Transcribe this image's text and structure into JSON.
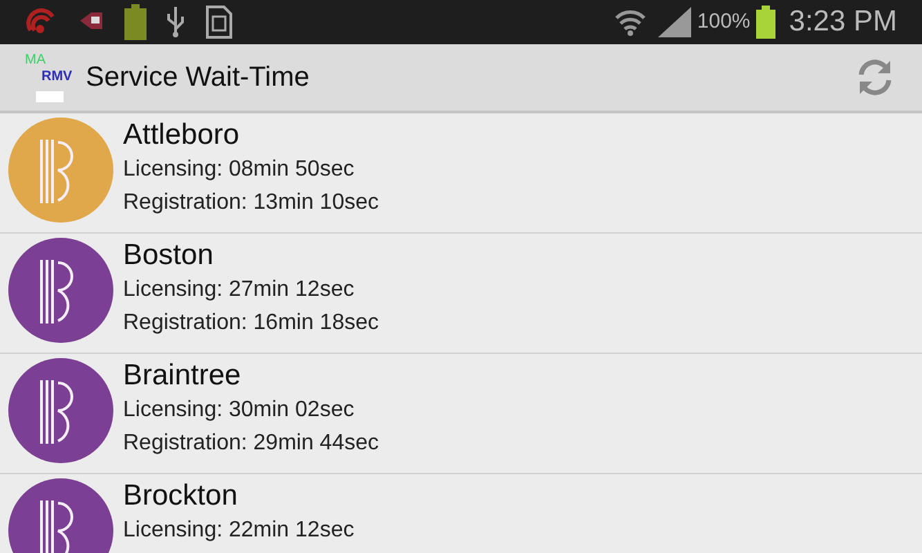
{
  "status_bar": {
    "battery_percent": "100%",
    "time": "3:23 PM"
  },
  "app_bar": {
    "logo": {
      "line_1": "MA",
      "line_2": "RMV"
    },
    "title": "Service Wait-Time"
  },
  "branches": [
    {
      "name": "Attleboro",
      "licensing": "Licensing: 08min 50sec",
      "registration": "Registration: 13min 10sec",
      "color": "#e0a84a"
    },
    {
      "name": "Boston",
      "licensing": "Licensing: 27min 12sec",
      "registration": "Registration: 16min 18sec",
      "color": "#7b3f93"
    },
    {
      "name": "Braintree",
      "licensing": "Licensing: 30min 02sec",
      "registration": "Registration: 29min 44sec",
      "color": "#7b3f93"
    },
    {
      "name": "Brockton",
      "licensing": "Licensing: 22min 12sec"
    }
  ]
}
